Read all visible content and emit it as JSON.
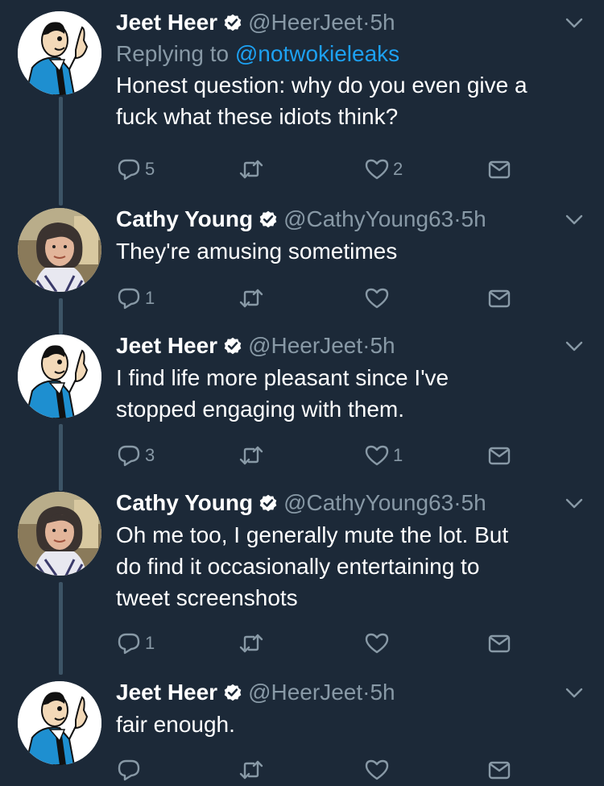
{
  "tweets": [
    {
      "name": "Jeet Heer",
      "handle": "@HeerJeet",
      "time": "5h",
      "reply_label": "Replying to",
      "reply_to": "@notwokieleaks",
      "lines": [
        "Honest question: why do you even give a",
        "fuck what these idiots think?"
      ],
      "replies": "5",
      "retweets": "",
      "likes": "2",
      "avatar": "cartoon-man-icon"
    },
    {
      "name": "Cathy Young",
      "handle": "@CathyYoung63",
      "time": "5h",
      "lines": [
        "They're amusing sometimes"
      ],
      "replies": "1",
      "retweets": "",
      "likes": "",
      "avatar": "woman-photo"
    },
    {
      "name": "Jeet Heer",
      "handle": "@HeerJeet",
      "time": "5h",
      "lines": [
        "I find life more pleasant since I've",
        "stopped engaging with them."
      ],
      "replies": "3",
      "retweets": "",
      "likes": "1",
      "avatar": "cartoon-man-icon"
    },
    {
      "name": "Cathy Young",
      "handle": "@CathyYoung63",
      "time": "5h",
      "lines": [
        "Oh me too, I generally mute the lot. But",
        "do find it occasionally entertaining to",
        "tweet screenshots"
      ],
      "replies": "1",
      "retweets": "",
      "likes": "",
      "avatar": "woman-photo"
    },
    {
      "name": "Jeet Heer",
      "handle": "@HeerJeet",
      "time": "5h",
      "lines": [
        "fair enough."
      ],
      "replies": "",
      "retweets": "",
      "likes": "",
      "avatar": "cartoon-man-icon"
    }
  ],
  "separator": "·",
  "colors": {
    "background": "#1c2938",
    "muted": "#8899a6",
    "link": "#1da1f2",
    "thread_line": "#3d5466"
  }
}
